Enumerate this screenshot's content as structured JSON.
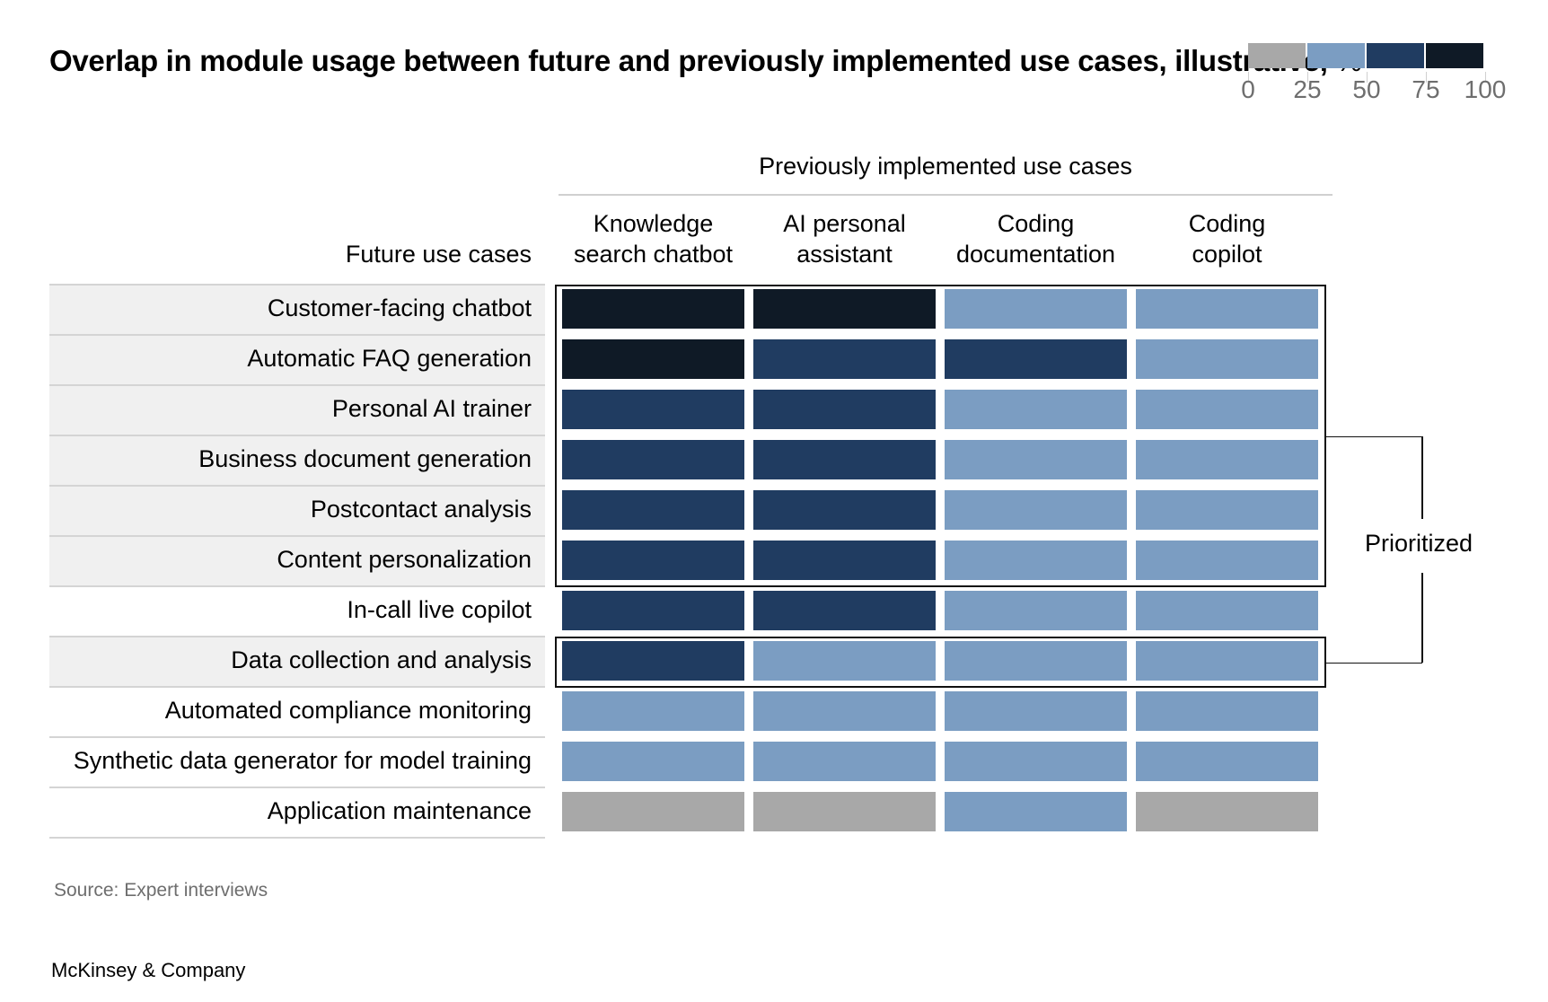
{
  "chart_data": {
    "type": "heatmap",
    "title": "Overlap in module usage between future and previously implemented use cases, illustrative,",
    "title_unit": "%",
    "x_group_label": "Previously implemented use cases",
    "y_group_label": "Future use cases",
    "columns": [
      {
        "line1": "Knowledge",
        "line2": "search chatbot"
      },
      {
        "line1": "AI personal",
        "line2": "assistant"
      },
      {
        "line1": "Coding",
        "line2": "documentation"
      },
      {
        "line1": "Coding",
        "line2": "copilot"
      }
    ],
    "rows": [
      {
        "label": "Customer-facing chatbot",
        "prioritized": true,
        "bins": [
          4,
          4,
          2,
          2
        ]
      },
      {
        "label": "Automatic FAQ generation",
        "prioritized": true,
        "bins": [
          4,
          3,
          3,
          2
        ]
      },
      {
        "label": "Personal AI trainer",
        "prioritized": true,
        "bins": [
          3,
          3,
          2,
          2
        ]
      },
      {
        "label": "Business document generation",
        "prioritized": true,
        "bins": [
          3,
          3,
          2,
          2
        ]
      },
      {
        "label": "Postcontact analysis",
        "prioritized": true,
        "bins": [
          3,
          3,
          2,
          2
        ]
      },
      {
        "label": "Content personalization",
        "prioritized": true,
        "bins": [
          3,
          3,
          2,
          2
        ]
      },
      {
        "label": "In-call live copilot",
        "prioritized": false,
        "bins": [
          3,
          3,
          2,
          2
        ]
      },
      {
        "label": "Data collection and analysis",
        "prioritized": true,
        "bins": [
          3,
          2,
          2,
          2
        ]
      },
      {
        "label": "Automated compliance monitoring",
        "prioritized": false,
        "bins": [
          2,
          2,
          2,
          2
        ]
      },
      {
        "label": "Synthetic data generator for model training",
        "prioritized": false,
        "bins": [
          2,
          2,
          2,
          2
        ]
      },
      {
        "label": "Application maintenance",
        "prioritized": false,
        "bins": [
          1,
          1,
          2,
          1
        ]
      }
    ],
    "bin_ranges": [
      {
        "bin": 1,
        "range": [
          0,
          25
        ],
        "color": "#a8a8a8"
      },
      {
        "bin": 2,
        "range": [
          25,
          50
        ],
        "color": "#7b9dc2"
      },
      {
        "bin": 3,
        "range": [
          50,
          75
        ],
        "color": "#203c61"
      },
      {
        "bin": 4,
        "range": [
          75,
          100
        ],
        "color": "#0f1a26"
      }
    ],
    "legend": {
      "tick_labels": [
        "0",
        "25",
        "50",
        "75",
        "100"
      ],
      "placement": "top-right"
    },
    "annotation": "Prioritized"
  },
  "footer": {
    "source": "Source: Expert interviews",
    "brand": "McKinsey & Company"
  }
}
